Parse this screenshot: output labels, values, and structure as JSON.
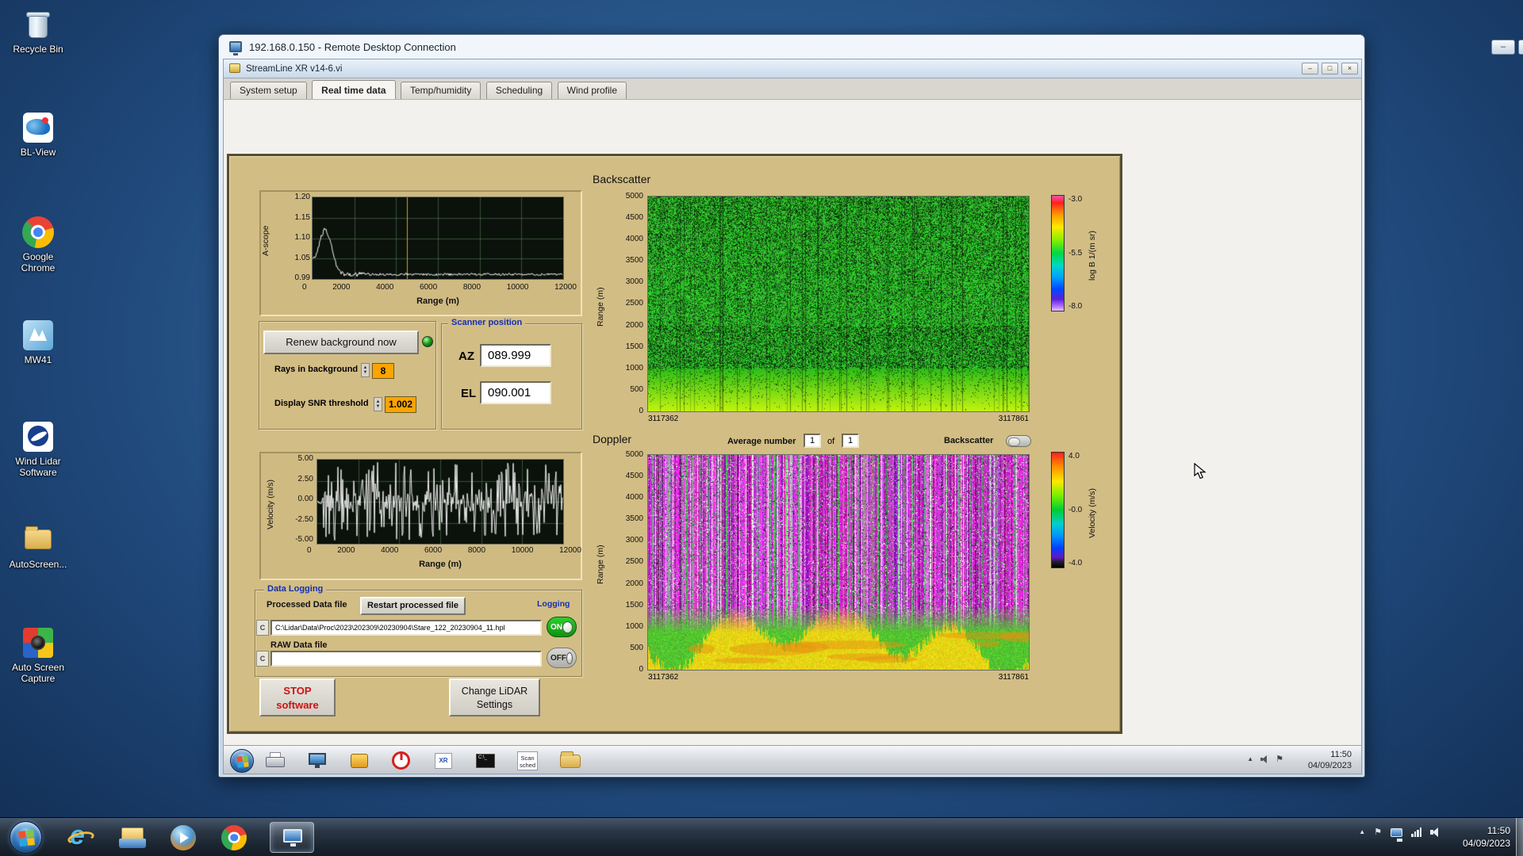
{
  "desktop": {
    "icons": [
      {
        "label": "Recycle Bin"
      },
      {
        "label": "BL-View"
      },
      {
        "label": "Google Chrome"
      },
      {
        "label": "MW41"
      },
      {
        "label": "Wind Lidar Software"
      },
      {
        "label": "AutoScreen..."
      },
      {
        "label": "Auto Screen Capture"
      }
    ]
  },
  "rdp": {
    "title": "192.168.0.150 - Remote Desktop Connection"
  },
  "app": {
    "title": "StreamLine XR v14-6.vi",
    "tabs": [
      "System setup",
      "Real time data",
      "Temp/humidity",
      "Scheduling",
      "Wind profile"
    ],
    "ascope": {
      "ylabel": "A-scope",
      "yticks": [
        "1.20",
        "1.15",
        "1.10",
        "1.05",
        "0.99"
      ],
      "xticks": [
        "0",
        "2000",
        "4000",
        "6000",
        "8000",
        "10000",
        "12000"
      ],
      "xlabel": "Range (m)"
    },
    "backscatter": {
      "title": "Backscatter",
      "ylabel": "Range (m)",
      "yticks": [
        "5000",
        "4500",
        "4000",
        "3500",
        "3000",
        "2500",
        "2000",
        "1500",
        "1000",
        "500",
        "0"
      ],
      "xleft": "3117362",
      "xright": "3117861",
      "cb_ticks": [
        "-3.0",
        "-5.5",
        "-8.0"
      ],
      "cb_label": "log B 1/(m sr)"
    },
    "controls": {
      "renew": "Renew background now",
      "rays_label": "Rays in background",
      "rays_value": "8",
      "snr_label": "Display SNR threshold",
      "snr_value": "1.002"
    },
    "scanner": {
      "title": "Scanner position",
      "az_label": "AZ",
      "az_value": "089.999",
      "el_label": "EL",
      "el_value": "090.001"
    },
    "doppler": {
      "title": "Doppler",
      "avg_label": "Average number",
      "avg_value": "1",
      "of": "of",
      "avg_count": "1",
      "toggle_label": "Backscatter",
      "ylabel": "Range (m)",
      "yticks": [
        "5000",
        "4500",
        "4000",
        "3500",
        "3000",
        "2500",
        "2000",
        "1500",
        "1000",
        "500",
        "0"
      ],
      "xleft": "3117362",
      "xright": "3117861",
      "cb_ticks": [
        "4.0",
        "-0.0",
        "-4.0"
      ],
      "cb_label": "Velocity (m/s)"
    },
    "velocity": {
      "ylabel": "Velocity (m/s)",
      "yticks": [
        "5.00",
        "2.50",
        "0.00",
        "-2.50",
        "-5.00"
      ],
      "xticks": [
        "0",
        "2000",
        "4000",
        "6000",
        "8000",
        "10000",
        "12000"
      ],
      "xlabel": "Range (m)"
    },
    "logging": {
      "title": "Data Logging",
      "processed_label": "Processed Data file",
      "restart": "Restart processed file",
      "logging_label": "Logging",
      "processed_path": "C:\\Lidar\\Data\\Proc\\2023\\202309\\20230904\\Stare_122_20230904_11.hpl",
      "on": "ON",
      "raw_label": "RAW Data file",
      "raw_path": "",
      "off": "OFF"
    },
    "stop_button": {
      "line1": "STOP",
      "line2": "software"
    },
    "change_button": {
      "line1": "Change LiDAR",
      "line2": "Settings"
    },
    "taskbar": {
      "time": "11:50",
      "date": "04/09/2023",
      "scan_line1": "Scan",
      "scan_line2": "sched"
    }
  },
  "host_taskbar": {
    "time": "11:50",
    "date": "04/09/2023"
  },
  "glyphs": {
    "minimize": "–",
    "maximize": "□",
    "close": "×",
    "tray_chevron": "▲",
    "tray_flag": "⚑"
  },
  "colors": {
    "panel_tan": "#d2bd85",
    "value_amber": "#fca400",
    "toggle_on_green": "#18b118",
    "stop_red": "#cc1111",
    "label_blue": "#1430b4"
  }
}
